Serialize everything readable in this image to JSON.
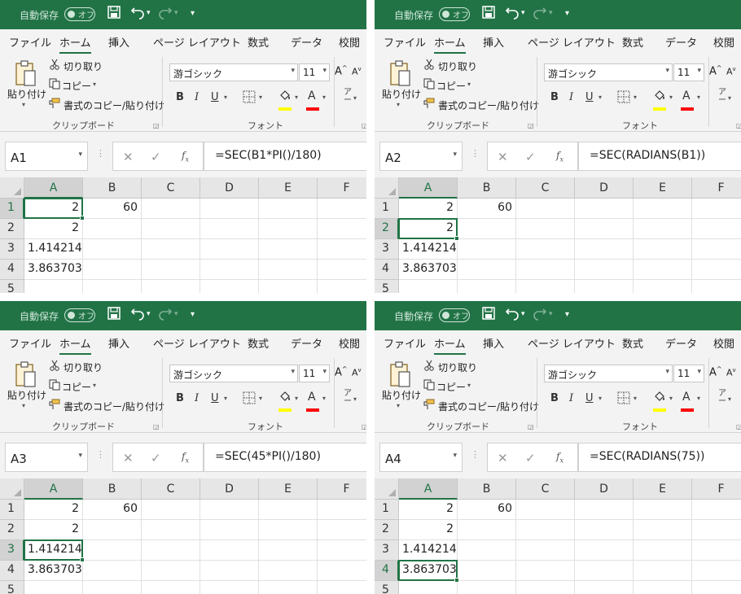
{
  "app": {
    "autosave_label": "自動保存",
    "autosave_state": "オフ",
    "quick_access_dropdown": "▾"
  },
  "tabs": [
    "ファイル",
    "ホーム",
    "挿入",
    "ページ レイアウト",
    "数式",
    "データ",
    "校閲"
  ],
  "ribbon": {
    "clipboard": {
      "paste_label": "貼り付け",
      "cut_label": "切り取り",
      "copy_label": "コピー",
      "format_painter_label": "書式のコピー/貼り付け",
      "group_label": "クリップボード"
    },
    "font": {
      "font_name": "游ゴシック",
      "font_size": "11",
      "grow_label": "A",
      "shrink_label": "A",
      "bold_label": "B",
      "italic_label": "I",
      "underline_label": "U",
      "font_color_label": "A",
      "group_label": "フォント",
      "highlight_color": "#ffff00",
      "font_color": "#ff0000"
    }
  },
  "columns": [
    "A",
    "B",
    "C",
    "D",
    "E",
    "F"
  ],
  "rows": [
    "1",
    "2",
    "3",
    "4",
    "5"
  ],
  "cells": {
    "A1": "2",
    "B1": "60",
    "A2": "2",
    "A3": "1.414214",
    "A4": "3.863703"
  },
  "panels": [
    {
      "name_box": "A1",
      "formula": "=SEC(B1*PI()/180)",
      "selected_row": 1
    },
    {
      "name_box": "A2",
      "formula": "=SEC(RADIANS(B1))",
      "selected_row": 2
    },
    {
      "name_box": "A3",
      "formula": "=SEC(45*PI()/180)",
      "selected_row": 3
    },
    {
      "name_box": "A4",
      "formula": "=SEC(RADIANS(75))",
      "selected_row": 4
    }
  ],
  "colors": {
    "accent": "#217346",
    "ribbon_bg": "#f3f3f3",
    "header_bg": "#e6e6e6"
  }
}
